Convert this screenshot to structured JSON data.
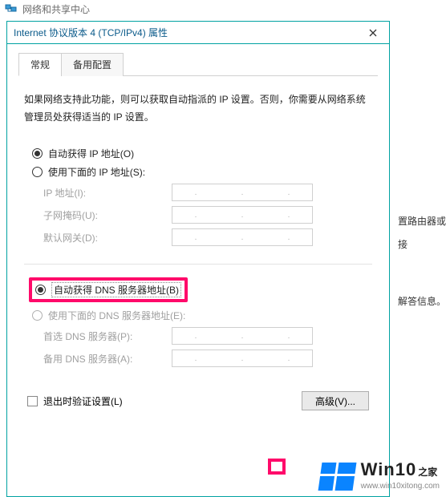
{
  "parent_window": {
    "title": "网络和共享中心"
  },
  "dialog": {
    "title": "Internet 协议版本 4 (TCP/IPv4) 属性",
    "tabs": {
      "general": "常规",
      "alt": "备用配置"
    },
    "description": "如果网络支持此功能，则可以获取自动指派的 IP 设置。否则，你需要从网络系统管理员处获得适当的 IP 设置。",
    "ip_group": {
      "auto": "自动获得 IP 地址(O)",
      "manual": "使用下面的 IP 地址(S):",
      "ip_label": "IP 地址(I):",
      "mask_label": "子网掩码(U):",
      "gateway_label": "默认网关(D):"
    },
    "dns_group": {
      "auto": "自动获得 DNS 服务器地址(B)",
      "manual": "使用下面的 DNS 服务器地址(E):",
      "pref_label": "首选 DNS 服务器(P):",
      "alt_label": "备用 DNS 服务器(A):"
    },
    "validate_on_exit": "退出时验证设置(L)",
    "advanced": "高级(V)..."
  },
  "side_hints": {
    "router": "置路由器或接",
    "miss": "解答信息。"
  },
  "brand": {
    "main": "Win10",
    "sub": "之家",
    "url": "www.win10xitong.com"
  }
}
